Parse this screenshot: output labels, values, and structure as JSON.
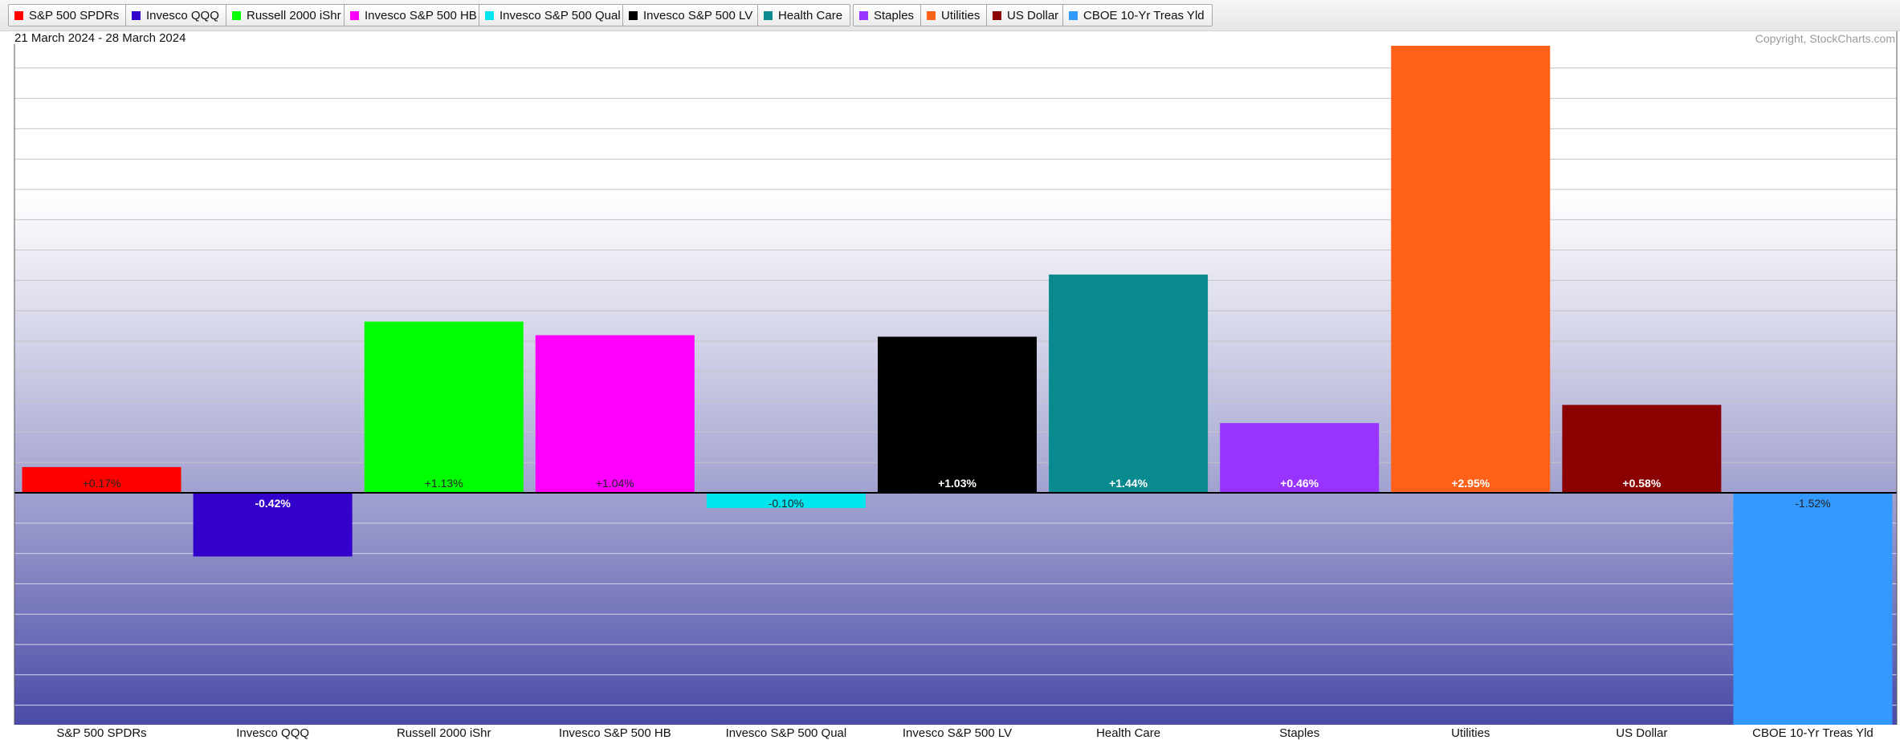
{
  "legend": [
    {
      "label": "S&P 500 SPDRs",
      "color": "#ff0000"
    },
    {
      "label": "Invesco QQQ",
      "color": "#3300cc"
    },
    {
      "label": "Russell 2000 iShr",
      "color": "#00ff00"
    },
    {
      "label": "Invesco S&P 500 HB",
      "color": "#ff00ff"
    },
    {
      "label": "Invesco S&P 500 Qual",
      "color": "#00e5ee"
    },
    {
      "label": "Invesco S&P 500 LV",
      "color": "#000000"
    },
    {
      "label": "Health Care",
      "color": "#088a8f"
    },
    {
      "label": "Staples",
      "color": "#9933ff"
    },
    {
      "label": "Utilities",
      "color": "#ff6119"
    },
    {
      "label": "US Dollar",
      "color": "#8b0000"
    },
    {
      "label": "CBOE 10-Yr Treas Yld",
      "color": "#3399ff"
    }
  ],
  "date_range": "21 March 2024 - 28 March 2024",
  "copyright": "Copyright, StockCharts.com",
  "chart_data": {
    "type": "bar",
    "title": "",
    "xlabel": "",
    "ylabel": "",
    "ylim": [
      -1.52,
      2.95
    ],
    "grid": true,
    "legend_placement": "top",
    "categories": [
      "S&P 500 SPDRs",
      "Invesco QQQ",
      "Russell 2000 iShr",
      "Invesco S&P 500 HB",
      "Invesco S&P 500 Qual",
      "Invesco S&P 500 LV",
      "Health Care",
      "Staples",
      "Utilities",
      "US Dollar",
      "CBOE 10-Yr Treas Yld"
    ],
    "values": [
      0.17,
      -0.42,
      1.13,
      1.04,
      -0.1,
      1.03,
      1.44,
      0.46,
      2.95,
      0.58,
      -1.52
    ],
    "data_labels": [
      "+0.17%",
      "-0.42%",
      "+1.13%",
      "+1.04%",
      "-0.10%",
      "+1.03%",
      "+1.44%",
      "+0.46%",
      "+2.95%",
      "+0.58%",
      "-1.52%"
    ],
    "colors": [
      "#ff0000",
      "#3300cc",
      "#00ff00",
      "#ff00ff",
      "#00e5ee",
      "#000000",
      "#088a8f",
      "#9933ff",
      "#ff6119",
      "#8b0000",
      "#3399ff"
    ]
  }
}
